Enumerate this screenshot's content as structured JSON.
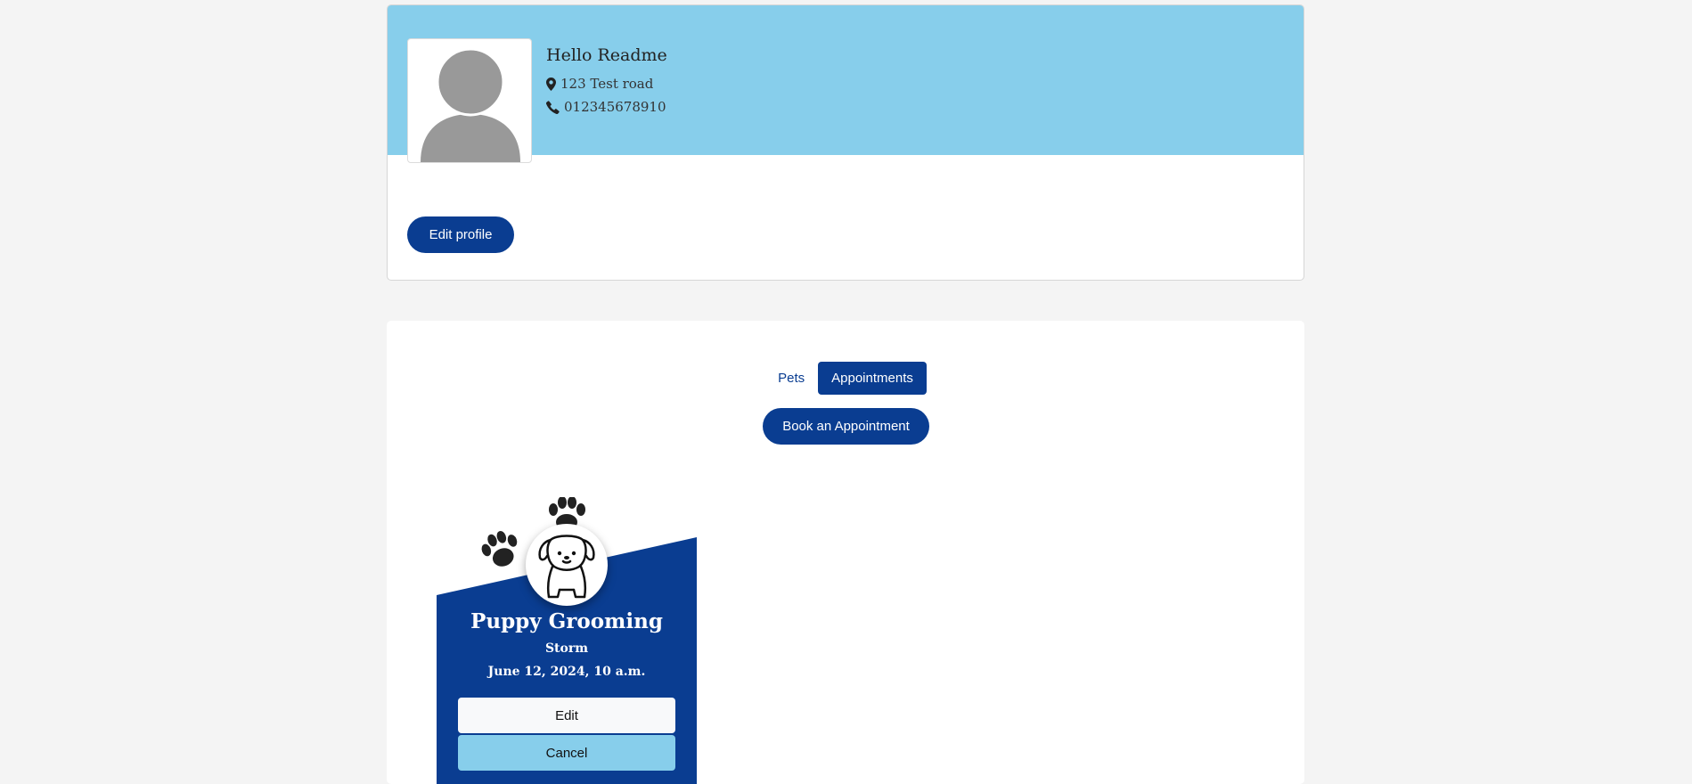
{
  "profile": {
    "name": "Hello Readme",
    "address": "123 Test road",
    "phone": "012345678910",
    "edit_label": "Edit profile"
  },
  "tabs": [
    {
      "label": "Pets",
      "active": false
    },
    {
      "label": "Appointments",
      "active": true
    }
  ],
  "book_label": "Book an Appointment",
  "appointment": {
    "service": "Puppy Grooming",
    "pet": "Storm",
    "datetime": "June 12, 2024, 10 a.m.",
    "edit_label": "Edit",
    "cancel_label": "Cancel"
  },
  "colors": {
    "banner": "#87ceeb",
    "primary": "#0a3d91",
    "page_bg": "#f4f4f4"
  },
  "icons": {
    "address": "map-marker-icon",
    "phone": "phone-icon",
    "avatar": "user-silhouette-icon",
    "pet": "puppy-icon",
    "paws": "paw-print-icon"
  }
}
